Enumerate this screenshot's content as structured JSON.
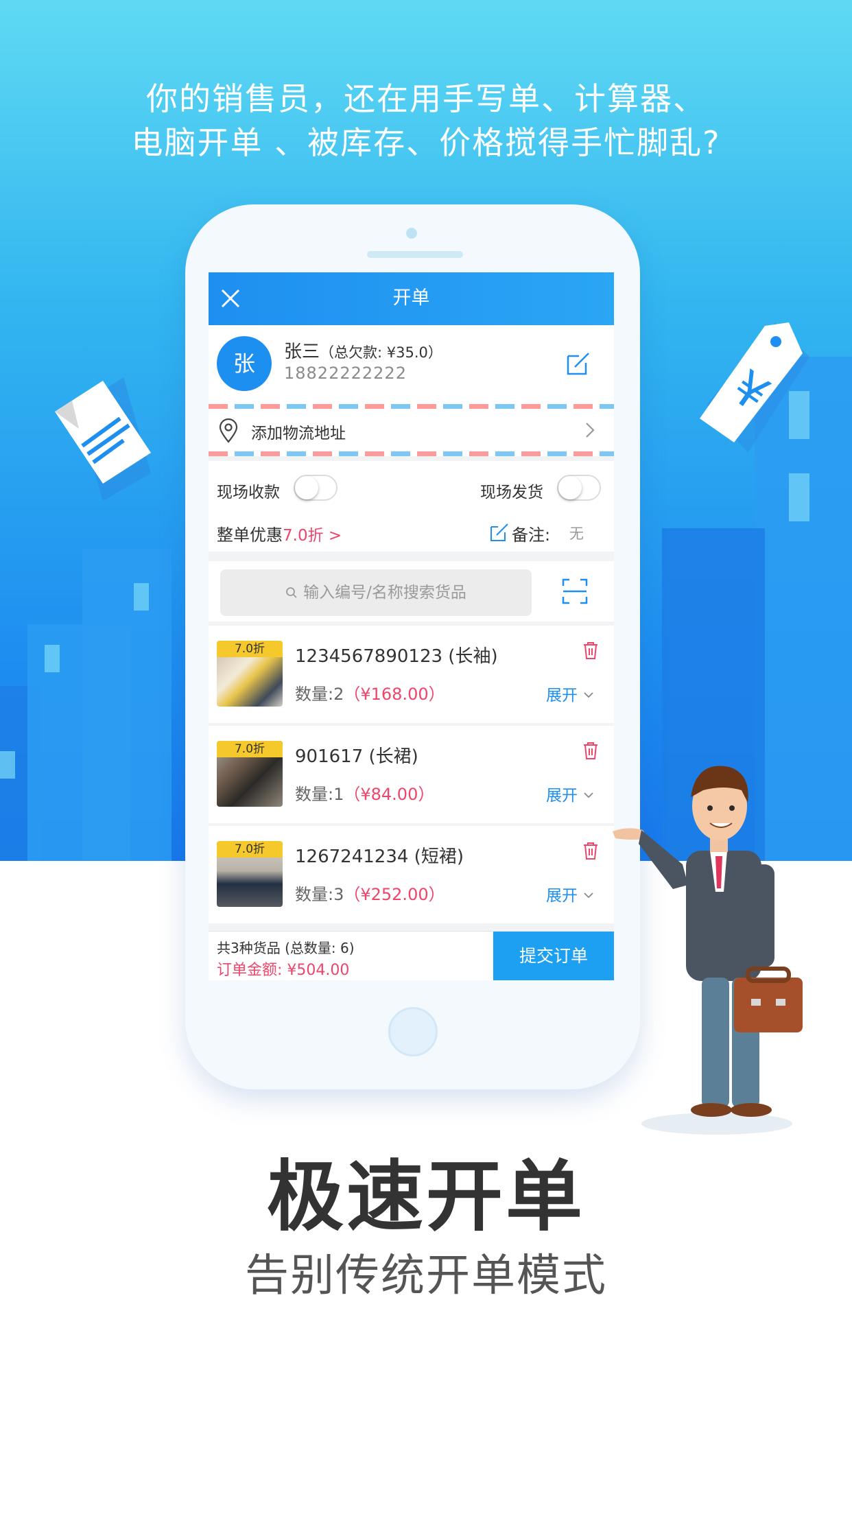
{
  "headline": {
    "line1": "你的销售员，还在用手写单、计算器、",
    "line2": "电脑开单 、被库存、价格搅得手忙脚乱?"
  },
  "app": {
    "title": "开单",
    "customer": {
      "avatar_char": "张",
      "name": "张三",
      "debt": "（总欠款: ¥35.0）",
      "phone": "18822222222"
    },
    "address_label": "添加物流地址",
    "options": {
      "collect_label": "现场收款",
      "collect_on": false,
      "ship_label": "现场发货",
      "ship_on": false,
      "discount_label": "整单优惠",
      "discount_value": "7.0折 >",
      "note_label": "备注:",
      "note_value": "无"
    },
    "search_placeholder": "输入编号/名称搜索货品",
    "items": [
      {
        "tag": "7.0折",
        "name": "1234567890123 (长袖)",
        "qty": "数量:2",
        "price": "（¥168.00）",
        "expand": "展开"
      },
      {
        "tag": "7.0折",
        "name": "901617 (长裙)",
        "qty": "数量:1",
        "price": "（¥84.00）",
        "expand": "展开"
      },
      {
        "tag": "7.0折",
        "name": "1267241234 (短裙)",
        "qty": "数量:3",
        "price": "（¥252.00）",
        "expand": "展开"
      }
    ],
    "footer": {
      "count": "共3种货品 (总数量: 6)",
      "total": "订单金额: ¥504.00",
      "submit": "提交订单"
    }
  },
  "colors": {
    "brand_blue": "#1d8ff0",
    "price_red": "#f0456a",
    "tag_yellow": "#f5c82b"
  },
  "icons": [
    "close-icon",
    "edit-icon",
    "location-pin-icon",
    "chevron-right-icon",
    "search-icon",
    "scan-icon",
    "trash-icon",
    "chevron-down-icon",
    "note-edit-icon",
    "document-icon",
    "yen-tag-icon"
  ],
  "tagline": {
    "title": "极速开单",
    "subtitle": "告别传统开单模式"
  }
}
